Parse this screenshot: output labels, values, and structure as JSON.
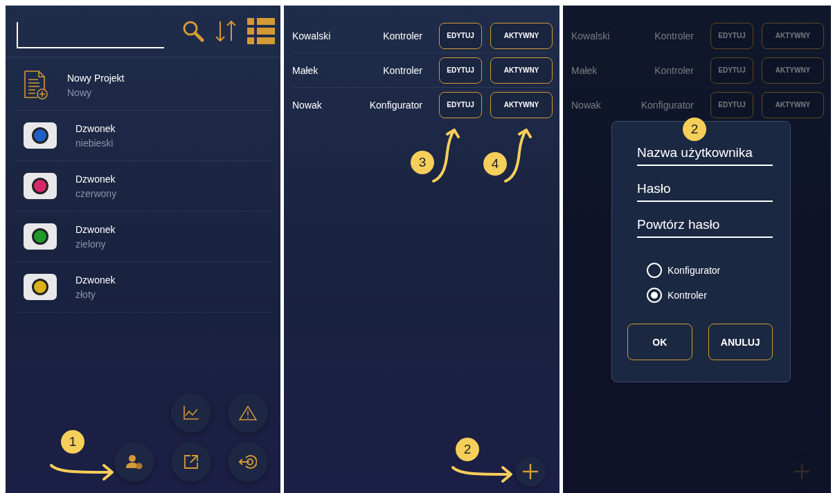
{
  "project_screen": {
    "projects": [
      {
        "kind": "new",
        "title": "Nowy Projekt",
        "subtitle": "Nowy"
      },
      {
        "kind": "photo",
        "title": "Dzwonek",
        "subtitle": "niebieski",
        "color": "#1f5fc4"
      },
      {
        "kind": "photo",
        "title": "Dzwonek",
        "subtitle": "czerwony",
        "color": "#d4286a"
      },
      {
        "kind": "photo",
        "title": "Dzwonek",
        "subtitle": "zielony",
        "color": "#1f9a2a"
      },
      {
        "kind": "photo",
        "title": "Dzwonek",
        "subtitle": "złoty",
        "color": "#d9b21a"
      }
    ],
    "callout": "1"
  },
  "users_screen": {
    "users": [
      {
        "name": "Kowalski",
        "role": "Kontroler",
        "edit": "EDYTUJ",
        "status": "AKTYWNY"
      },
      {
        "name": "Małek",
        "role": "Kontroler",
        "edit": "EDYTUJ",
        "status": "AKTYWNY"
      },
      {
        "name": "Nowak",
        "role": "Konfigurator",
        "edit": "EDYTUJ",
        "status": "AKTYWNY"
      }
    ],
    "callouts": [
      {
        "kind": "edit",
        "label": "3"
      },
      {
        "kind": "status",
        "label": "4"
      },
      {
        "kind": "add",
        "label": "2"
      }
    ]
  },
  "dialog_screen": {
    "users": [
      {
        "name": "Kowalski",
        "role": "Kontroler",
        "edit": "EDYTUJ",
        "status": "AKTYWNY"
      },
      {
        "name": "Małek",
        "role": "Kontroler",
        "edit": "EDYTUJ",
        "status": "AKTYWNY"
      },
      {
        "name": "Nowak",
        "role": "Konfigurator",
        "edit": "EDYTUJ",
        "status": "AKTYWNY"
      }
    ],
    "dialog": {
      "callout": "2",
      "fields": [
        {
          "placeholder": "Nazwa użytkownika"
        },
        {
          "placeholder": "Hasło"
        },
        {
          "placeholder": "Powtórz hasło"
        }
      ],
      "roles": [
        {
          "label": "Konfigurator",
          "selected": false
        },
        {
          "label": "Kontroler",
          "selected": true
        }
      ],
      "buttons": [
        "OK",
        "ANULUJ"
      ]
    }
  }
}
